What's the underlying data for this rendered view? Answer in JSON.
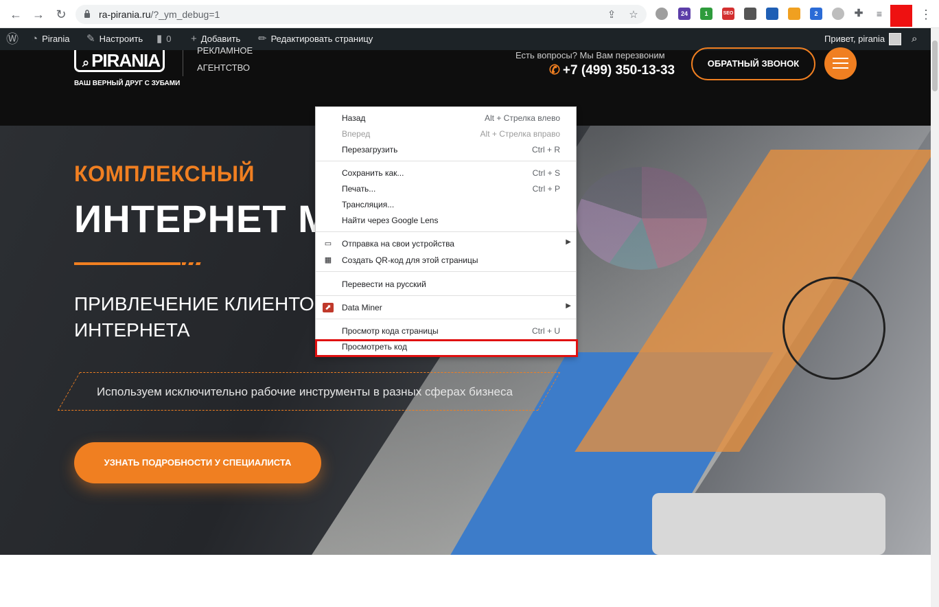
{
  "browser": {
    "url_host": "ra-pirania.ru",
    "url_path": "/?_ym_debug=1",
    "extensions": [
      {
        "name": "ext-24",
        "label": "24",
        "color": "#5c3ea8"
      },
      {
        "name": "ext-1",
        "label": "1",
        "color": "#2e9b3c"
      },
      {
        "name": "ext-seo",
        "label": "SEO",
        "color": "#d32f2f"
      },
      {
        "name": "ext-2",
        "label": "2",
        "color": "#2b6bd6"
      }
    ]
  },
  "wp_admin_bar": {
    "site_name": "Pirania",
    "customize": "Настроить",
    "comments_count": "0",
    "add_new": "Добавить",
    "edit_page": "Редактировать страницу",
    "greeting": "Привет, pirania"
  },
  "header": {
    "logo": "PIRANIA",
    "tagline": "ВАШ ВЕРНЫЙ ДРУГ С ЗУБАМИ",
    "agency_line1": "РЕКЛАМНОЕ",
    "agency_line2": "АГЕНТСТВО",
    "callback_question": "Есть вопросы? Мы Вам перезвоним",
    "phone": "+7 (499) 350-13-33",
    "callback_button": "ОБРАТНЫЙ ЗВОНОК"
  },
  "hero": {
    "kicker": "КОМПЛЕКСНЫЙ",
    "title": "ИНТЕРНЕТ МА",
    "subtitle_line1": "ПРИВЛЕЧЕНИЕ КЛИЕНТОВ",
    "subtitle_line2": "ИНТЕРНЕТА",
    "tagline": "Используем исключительно рабочие инструменты в разных сферах бизнеса",
    "cta": "УЗНАТЬ ПОДРОБНОСТИ У СПЕЦИАЛИСТА"
  },
  "context_menu": {
    "items": [
      {
        "label": "Назад",
        "shortcut": "Alt + Стрелка влево",
        "disabled": false
      },
      {
        "label": "Вперед",
        "shortcut": "Alt + Стрелка вправо",
        "disabled": true
      },
      {
        "label": "Перезагрузить",
        "shortcut": "Ctrl + R",
        "disabled": false
      },
      {
        "label": "Сохранить как...",
        "shortcut": "Ctrl + S",
        "disabled": false
      },
      {
        "label": "Печать...",
        "shortcut": "Ctrl + P",
        "disabled": false
      },
      {
        "label": "Трансляция...",
        "shortcut": "",
        "disabled": false
      },
      {
        "label": "Найти через Google Lens",
        "shortcut": "",
        "disabled": false
      },
      {
        "label": "Отправка на свои устройства",
        "shortcut": "",
        "disabled": false
      },
      {
        "label": "Создать QR-код для этой страницы",
        "shortcut": "",
        "disabled": false
      },
      {
        "label": "Перевести на русский",
        "shortcut": "",
        "disabled": false
      },
      {
        "label": "Data Miner",
        "shortcut": "",
        "disabled": false
      },
      {
        "label": "Просмотр кода страницы",
        "shortcut": "Ctrl + U",
        "disabled": false
      },
      {
        "label": "Просмотреть код",
        "shortcut": "",
        "disabled": false
      }
    ],
    "highlight_color": "#e01010"
  },
  "colors": {
    "accent": "#f07f21",
    "admin_bar": "#1d2327"
  }
}
